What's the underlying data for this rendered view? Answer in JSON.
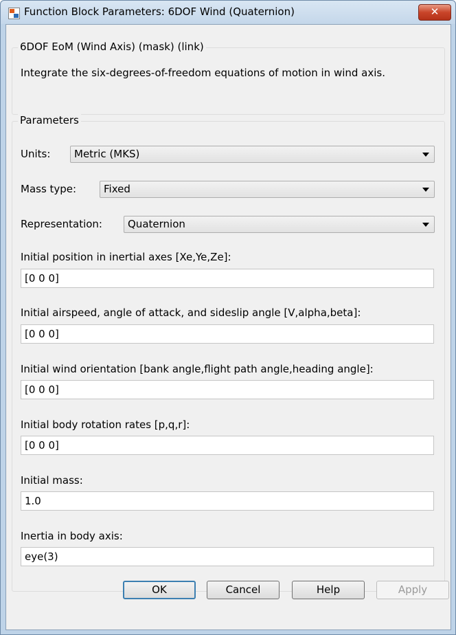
{
  "window": {
    "title": "Function Block Parameters: 6DOF Wind (Quaternion)",
    "close_label": "✕"
  },
  "header": {
    "group_title": "6DOF EoM (Wind Axis) (mask) (link)",
    "description": "Integrate the six-degrees-of-freedom equations of motion in wind axis."
  },
  "params": {
    "group_title": "Parameters",
    "units": {
      "label": "Units:",
      "value": "Metric (MKS)"
    },
    "mass_type": {
      "label": "Mass type:",
      "value": "Fixed"
    },
    "representation": {
      "label": "Representation:",
      "value": "Quaternion"
    },
    "fields": [
      {
        "label": "Initial position in inertial axes [Xe,Ye,Ze]:",
        "value": "[0 0 0]"
      },
      {
        "label": "Initial airspeed, angle of attack, and sideslip angle [V,alpha,beta]:",
        "value": "[0 0 0]"
      },
      {
        "label": "Initial wind orientation [bank angle,flight path angle,heading angle]:",
        "value": "[0 0 0]"
      },
      {
        "label": "Initial body rotation rates [p,q,r]:",
        "value": "[0 0 0]"
      },
      {
        "label": "Initial mass:",
        "value": "1.0"
      },
      {
        "label": "Inertia in body axis:",
        "value": "eye(3)"
      }
    ]
  },
  "buttons": {
    "ok": "OK",
    "cancel": "Cancel",
    "help": "Help",
    "apply": "Apply"
  }
}
